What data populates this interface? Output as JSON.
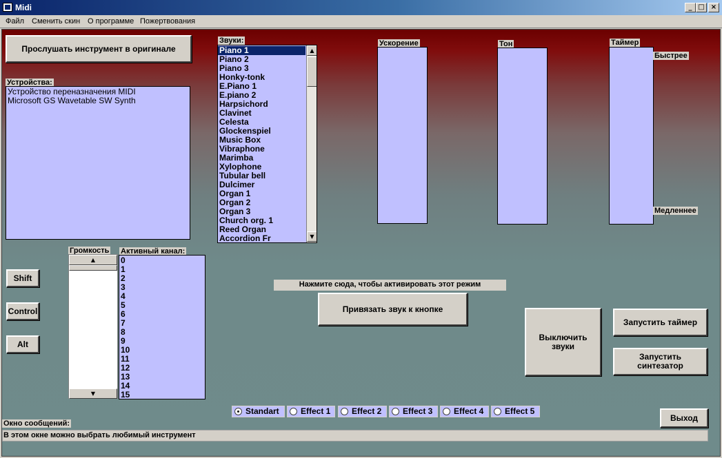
{
  "window": {
    "title": "Midi",
    "minimize": "_",
    "maximize": "□",
    "close": "×"
  },
  "menu": [
    "Файл",
    "Сменить скин",
    "О программе",
    "Пожертвования"
  ],
  "buttons": {
    "listen_original": "Прослушать инструмент в оригинале",
    "shift": "Shift",
    "control": "Control",
    "alt": "Alt",
    "bind_sound": "Привязать звук к кнопке",
    "mute": "Выключить звуки",
    "start_timer": "Запустить таймер",
    "start_synth": "Запустить синтезатор",
    "exit": "Выход"
  },
  "devices": {
    "label": "Устройства:",
    "items": [
      "Устройство переназначения MIDI",
      "Microsoft GS Wavetable SW Synth"
    ]
  },
  "sounds": {
    "label": "Звуки:",
    "selected_index": 0,
    "items": [
      "Piano 1",
      "Piano 2",
      "Piano 3",
      "Honky-tonk",
      "E.Piano 1",
      "E.piano 2",
      "Harpsichord",
      "Clavinet",
      "Celesta",
      "Glockenspiel",
      "Music Box",
      "Vibraphone",
      "Marimba",
      "Xylophone",
      "Tubular bell",
      "Dulcimer",
      "Organ 1",
      "Organ 2",
      "Organ 3",
      "Church org. 1",
      "Reed Organ",
      "Accordion Fr"
    ]
  },
  "sliders": {
    "acceleration": "Ускорение",
    "tone": "Тон",
    "timer": "Таймер",
    "faster": "Быстрее",
    "slower": "Медленнее"
  },
  "volume": {
    "label": "Громкость"
  },
  "channels": {
    "label": "Активный канал:",
    "items": [
      "0",
      "1",
      "2",
      "3",
      "4",
      "5",
      "6",
      "7",
      "8",
      "9",
      "10",
      "11",
      "12",
      "13",
      "14",
      "15"
    ]
  },
  "hint": "Нажмите сюда, чтобы активировать этот режим",
  "effects": {
    "selected": "Standart",
    "items": [
      "Standart",
      "Effect 1",
      "Effect 2",
      "Effect 3",
      "Effect 4",
      "Effect 5"
    ]
  },
  "messages": {
    "label": "Окно сообщений:",
    "text": "В этом окне можно выбрать любимый инструмент"
  },
  "colors": {
    "panel": "#c0c0ff",
    "titlebar": "#0a246a",
    "background_top": "#6b0000",
    "background_bottom": "#6f8b8b"
  }
}
